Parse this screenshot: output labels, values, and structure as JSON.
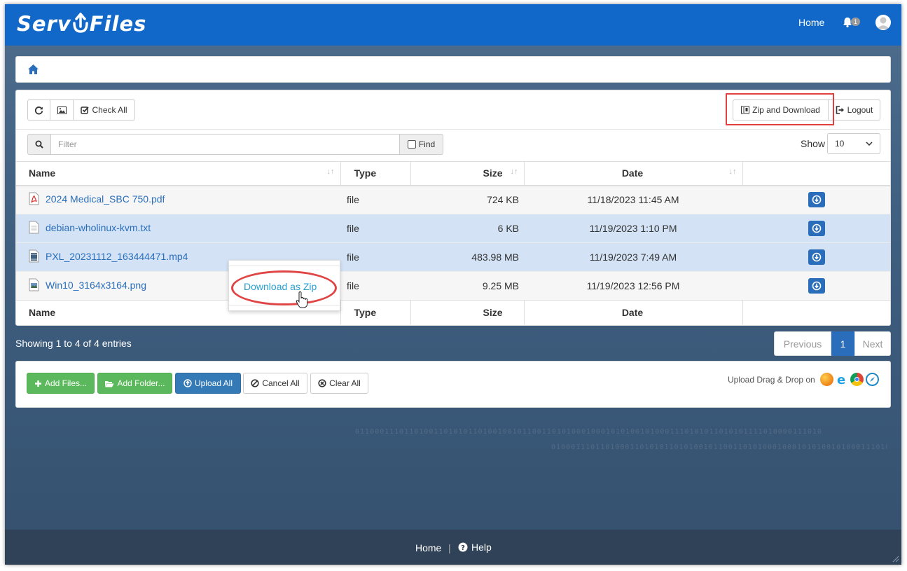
{
  "app": {
    "brand_left": "Serv",
    "brand_right": "Files",
    "nav_home": "Home",
    "notification_count": "1"
  },
  "toolbar": {
    "check_all": "Check All",
    "zip_download": "Zip and Download",
    "logout": "Logout"
  },
  "filter": {
    "placeholder": "Filter",
    "find": "Find",
    "show_label": "Show",
    "show_value": "10"
  },
  "table": {
    "headers": {
      "name": "Name",
      "type": "Type",
      "size": "Size",
      "date": "Date"
    },
    "rows": [
      {
        "name": "2024 Medical_SBC 750.pdf",
        "type": "file",
        "size": "724 KB",
        "date": "11/18/2023 11:45 AM",
        "icon": "pdf-icon"
      },
      {
        "name": "debian-wholinux-kvm.txt",
        "type": "file",
        "size": "6 KB",
        "date": "11/19/2023 1:10 PM",
        "icon": "text-file-icon"
      },
      {
        "name": "PXL_20231112_163444471.mp4",
        "type": "file",
        "size": "483.98 MB",
        "date": "11/19/2023 7:49 AM",
        "icon": "video-file-icon"
      },
      {
        "name": "Win10_3164x3164.png",
        "type": "file",
        "size": "9.25 MB",
        "date": "11/19/2023 12:56 PM",
        "icon": "image-file-icon"
      }
    ]
  },
  "context_menu": {
    "item": "Download as Zip"
  },
  "pagination": {
    "info": "Showing 1 to 4 of 4 entries",
    "previous": "Previous",
    "current": "1",
    "next": "Next"
  },
  "upload": {
    "add_files": "Add Files...",
    "add_folder": "Add Folder...",
    "upload_all": "Upload All",
    "cancel_all": "Cancel All",
    "clear_all": "Clear All",
    "drag_drop": "Upload Drag & Drop on"
  },
  "footer": {
    "home": "Home",
    "separator": "|",
    "help": "Help"
  },
  "colors": {
    "navbar": "#1168c9",
    "link": "#2a6ebb",
    "selected_row": "#d3e3f5",
    "highlight": "#e04040",
    "green_button": "#5cb85c",
    "footer": "#2f4257"
  }
}
